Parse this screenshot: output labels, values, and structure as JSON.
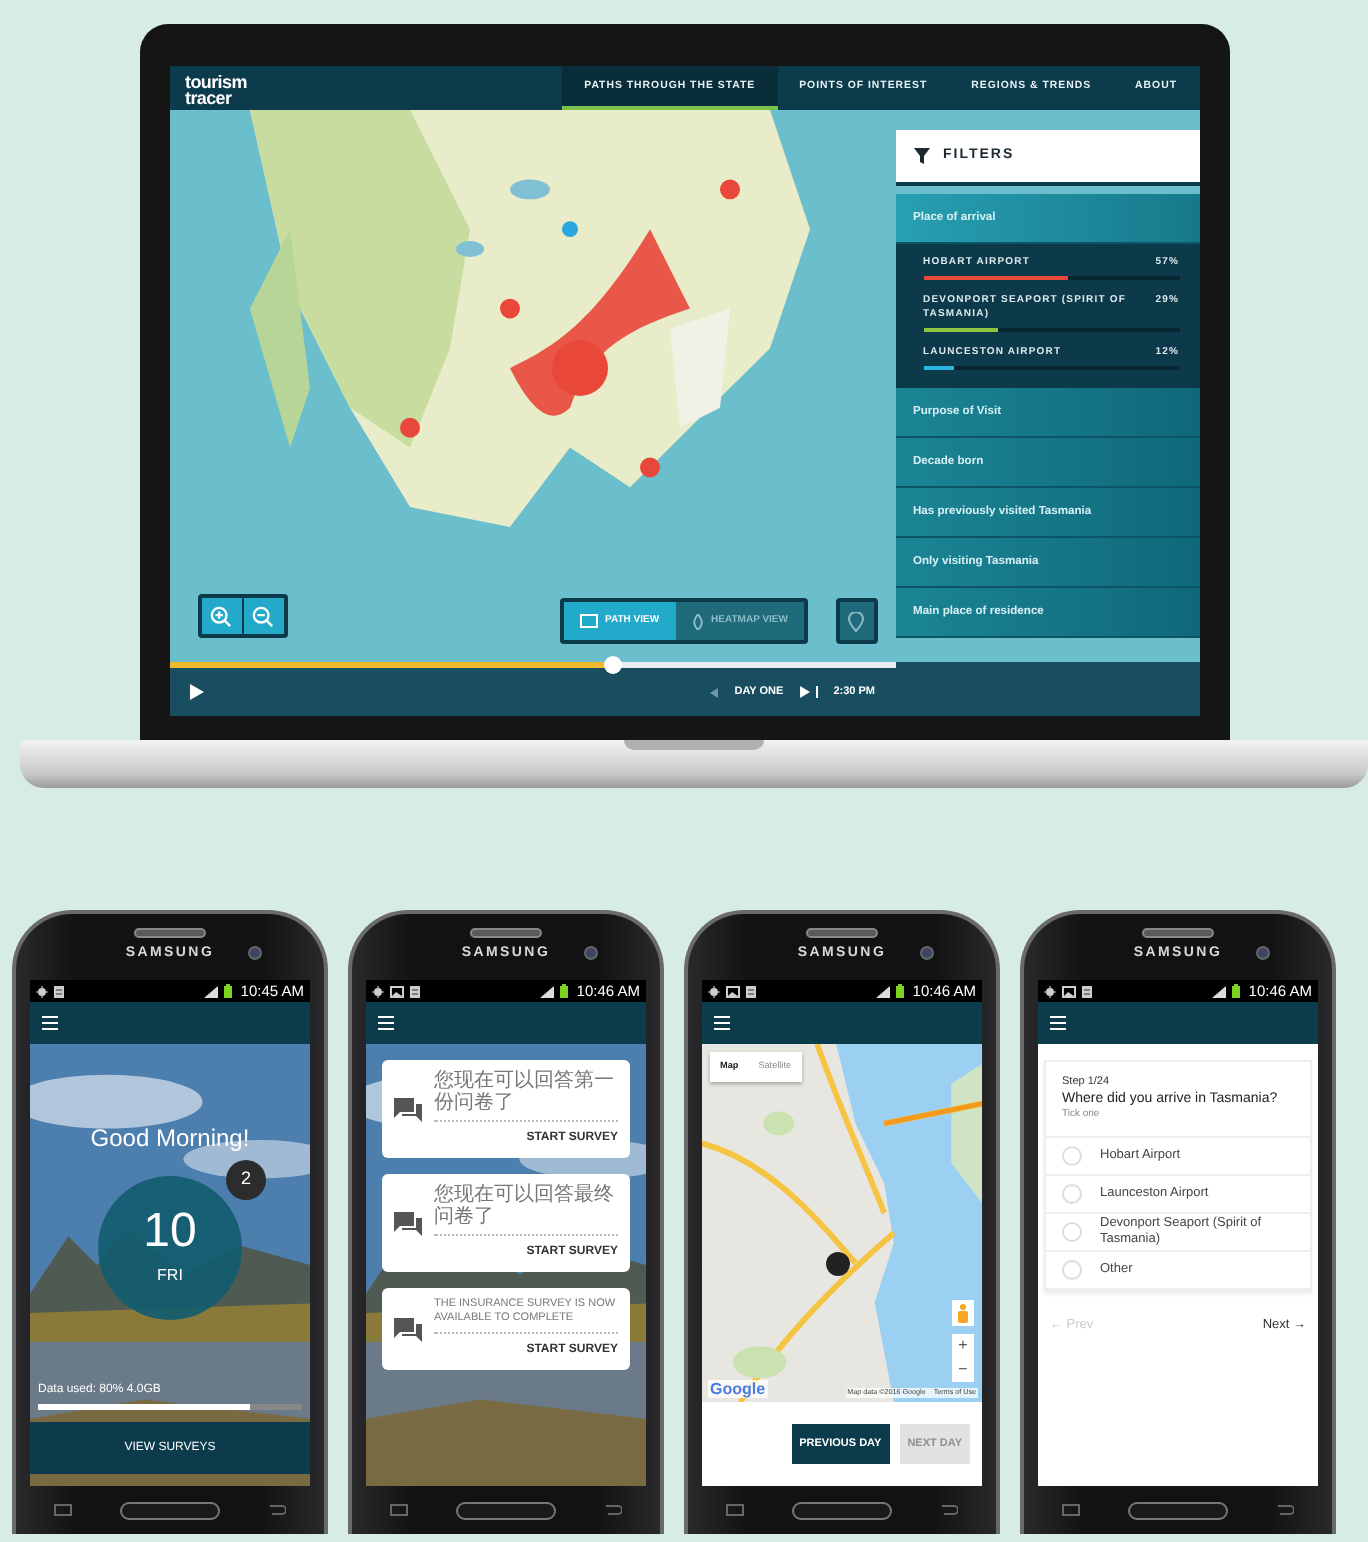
{
  "laptop": {
    "logo_lines": [
      "tourism",
      "tracer"
    ],
    "nav": [
      {
        "label": "PATHS THROUGH THE STATE",
        "selected": true
      },
      {
        "label": "POINTS OF INTEREST",
        "selected": false
      },
      {
        "label": "REGIONS & TRENDS",
        "selected": false
      },
      {
        "label": "ABOUT",
        "selected": false
      }
    ],
    "filters": {
      "title": "FILTERS",
      "sections": [
        {
          "label": "Place of arrival",
          "expanded": true,
          "items": [
            {
              "label": "HOBART AIRPORT",
              "value": "57%",
              "level": 0.57,
              "color": "#e8493a"
            },
            {
              "label": "DEVONPORT SEAPORT (SPIRIT OF TASMANIA)",
              "value": "29%",
              "level": 0.29,
              "color": "#8cc63f"
            },
            {
              "label": "LAUNCESTON AIRPORT",
              "value": "12%",
              "level": 0.12,
              "color": "#29b6e0"
            }
          ]
        },
        {
          "label": "Purpose of Visit",
          "expanded": false
        },
        {
          "label": "Decade born",
          "expanded": false
        },
        {
          "label": "Has previously visited Tasmania",
          "expanded": false
        },
        {
          "label": "Only visiting Tasmania",
          "expanded": false
        },
        {
          "label": "Main place of residence",
          "expanded": false
        }
      ]
    },
    "view_toggle": [
      {
        "label": "PATH VIEW",
        "selected": true
      },
      {
        "label": "HEATMAP VIEW",
        "selected": false
      }
    ],
    "timeline": {
      "level": 0.61,
      "day": "DAY ONE",
      "time": "2:30 PM"
    }
  },
  "phones": [
    {
      "kind": "home",
      "brand": "SAMSUNG",
      "time": "10:45 AM",
      "greeting": "Good Morning!",
      "day_number": "10",
      "weekday": "FRI",
      "badge": "2",
      "data_label": "Data used:  80% 4.0GB",
      "level": 0.8,
      "button": "VIEW SURVEYS"
    },
    {
      "kind": "surveys",
      "brand": "SAMSUNG",
      "time": "10:46 AM",
      "cards": [
        {
          "text": "您现在可以回答第一份问卷了",
          "action": "START SURVEY"
        },
        {
          "text": "您现在可以回答最终问卷了",
          "action": "START SURVEY"
        },
        {
          "text": "THE INSURANCE SURVEY IS NOW AVAILABLE TO COMPLETE",
          "action": "START SURVEY"
        }
      ]
    },
    {
      "kind": "map",
      "brand": "SAMSUNG",
      "time": "10:46 AM",
      "map_types": [
        {
          "label": "Map",
          "selected": true
        },
        {
          "label": "Satellite",
          "selected": false
        }
      ],
      "logo": "Google",
      "attribution": "Map data ©2016 Google",
      "terms": "Terms of Use",
      "zoom_in": "+",
      "zoom_out": "−",
      "buttons": [
        {
          "label": "PREVIOUS DAY",
          "disabled": false
        },
        {
          "label": "NEXT DAY",
          "disabled": true
        }
      ]
    },
    {
      "kind": "question",
      "brand": "SAMSUNG",
      "time": "10:46 AM",
      "step": "Step 1/24",
      "question": "Where did you arrive in Tasmania?",
      "hint": "Tick one",
      "options": [
        {
          "label": "Hobart Airport",
          "selected": false
        },
        {
          "label": "Launceston Airport",
          "selected": false
        },
        {
          "label": "Devonport Seaport (Spirit of Tasmania)",
          "selected": false
        },
        {
          "label": "Other",
          "selected": false
        }
      ],
      "prev": {
        "label": "← Prev",
        "disabled": true
      },
      "next": {
        "label": "Next →",
        "disabled": false
      }
    }
  ]
}
